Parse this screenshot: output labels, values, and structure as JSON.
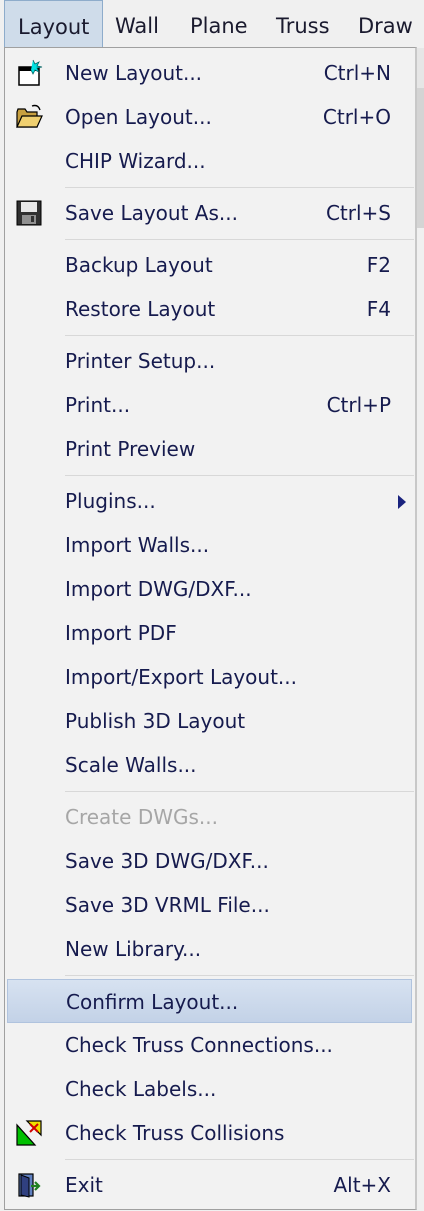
{
  "menubar": {
    "items": [
      "Layout",
      "Wall",
      "Plane",
      "Truss",
      "Draw"
    ]
  },
  "menu": {
    "new_layout": {
      "label": "New Layout...",
      "shortcut": "Ctrl+N",
      "icon": "new-layout-icon"
    },
    "open_layout": {
      "label": "Open Layout...",
      "shortcut": "Ctrl+O",
      "icon": "folder-open-icon"
    },
    "chip_wizard": {
      "label": "CHIP Wizard..."
    },
    "save_layout_as": {
      "label": "Save Layout As...",
      "shortcut": "Ctrl+S",
      "icon": "floppy-disk-icon"
    },
    "backup_layout": {
      "label": "Backup Layout",
      "shortcut": "F2"
    },
    "restore_layout": {
      "label": "Restore Layout",
      "shortcut": "F4"
    },
    "printer_setup": {
      "label": "Printer Setup..."
    },
    "print": {
      "label": "Print...",
      "shortcut": "Ctrl+P"
    },
    "print_preview": {
      "label": "Print Preview"
    },
    "plugins": {
      "label": "Plugins..."
    },
    "import_walls": {
      "label": "Import Walls..."
    },
    "import_dwg_dxf": {
      "label": "Import DWG/DXF..."
    },
    "import_pdf": {
      "label": "Import PDF"
    },
    "import_export_layout": {
      "label": "Import/Export Layout..."
    },
    "publish_3d_layout": {
      "label": "Publish 3D Layout"
    },
    "scale_walls": {
      "label": "Scale Walls..."
    },
    "create_dwgs": {
      "label": "Create DWGs..."
    },
    "save_3d_dwg_dxf": {
      "label": "Save 3D DWG/DXF..."
    },
    "save_3d_vrml": {
      "label": "Save 3D VRML File..."
    },
    "new_library": {
      "label": "New Library..."
    },
    "confirm_layout": {
      "label": "Confirm Layout..."
    },
    "check_truss_connections": {
      "label": "Check Truss Connections..."
    },
    "check_labels": {
      "label": "Check Labels..."
    },
    "check_truss_collisions": {
      "label": "Check Truss Collisions",
      "icon": "truss-collision-icon"
    },
    "exit": {
      "label": "Exit",
      "shortcut": "Alt+X",
      "icon": "exit-door-icon"
    }
  },
  "colors": {
    "text": "#161b4e",
    "disabled": "#a6a6a6",
    "highlight": "#c8d6ea",
    "menubar_active": "#cfdcea"
  }
}
